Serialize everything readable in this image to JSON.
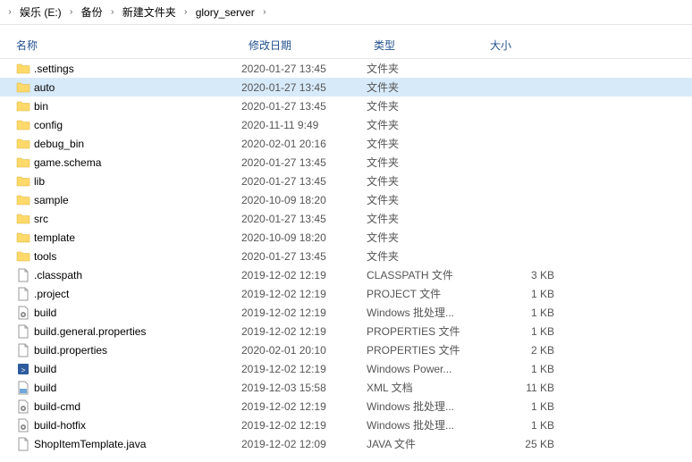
{
  "breadcrumb": [
    "娱乐 (E:)",
    "备份",
    "新建文件夹",
    "glory_server"
  ],
  "columns": {
    "name": "名称",
    "date": "修改日期",
    "type": "类型",
    "size": "大小"
  },
  "files": [
    {
      "icon": "folder",
      "name": ".settings",
      "date": "2020-01-27 13:45",
      "type": "文件夹",
      "size": "",
      "selected": false
    },
    {
      "icon": "folder",
      "name": "auto",
      "date": "2020-01-27 13:45",
      "type": "文件夹",
      "size": "",
      "selected": true
    },
    {
      "icon": "folder",
      "name": "bin",
      "date": "2020-01-27 13:45",
      "type": "文件夹",
      "size": "",
      "selected": false
    },
    {
      "icon": "folder",
      "name": "config",
      "date": "2020-11-11 9:49",
      "type": "文件夹",
      "size": "",
      "selected": false
    },
    {
      "icon": "folder",
      "name": "debug_bin",
      "date": "2020-02-01 20:16",
      "type": "文件夹",
      "size": "",
      "selected": false
    },
    {
      "icon": "folder",
      "name": "game.schema",
      "date": "2020-01-27 13:45",
      "type": "文件夹",
      "size": "",
      "selected": false
    },
    {
      "icon": "folder",
      "name": "lib",
      "date": "2020-01-27 13:45",
      "type": "文件夹",
      "size": "",
      "selected": false
    },
    {
      "icon": "folder",
      "name": "sample",
      "date": "2020-10-09 18:20",
      "type": "文件夹",
      "size": "",
      "selected": false
    },
    {
      "icon": "folder",
      "name": "src",
      "date": "2020-01-27 13:45",
      "type": "文件夹",
      "size": "",
      "selected": false
    },
    {
      "icon": "folder",
      "name": "template",
      "date": "2020-10-09 18:20",
      "type": "文件夹",
      "size": "",
      "selected": false
    },
    {
      "icon": "folder",
      "name": "tools",
      "date": "2020-01-27 13:45",
      "type": "文件夹",
      "size": "",
      "selected": false
    },
    {
      "icon": "file",
      "name": ".classpath",
      "date": "2019-12-02 12:19",
      "type": "CLASSPATH 文件",
      "size": "3 KB",
      "selected": false
    },
    {
      "icon": "file",
      "name": ".project",
      "date": "2019-12-02 12:19",
      "type": "PROJECT 文件",
      "size": "1 KB",
      "selected": false
    },
    {
      "icon": "gear",
      "name": "build",
      "date": "2019-12-02 12:19",
      "type": "Windows 批处理...",
      "size": "1 KB",
      "selected": false
    },
    {
      "icon": "file",
      "name": "build.general.properties",
      "date": "2019-12-02 12:19",
      "type": "PROPERTIES 文件",
      "size": "1 KB",
      "selected": false
    },
    {
      "icon": "file",
      "name": "build.properties",
      "date": "2020-02-01 20:10",
      "type": "PROPERTIES 文件",
      "size": "2 KB",
      "selected": false
    },
    {
      "icon": "ps",
      "name": "build",
      "date": "2019-12-02 12:19",
      "type": "Windows Power...",
      "size": "1 KB",
      "selected": false
    },
    {
      "icon": "xml",
      "name": "build",
      "date": "2019-12-03 15:58",
      "type": "XML 文档",
      "size": "11 KB",
      "selected": false
    },
    {
      "icon": "gear",
      "name": "build-cmd",
      "date": "2019-12-02 12:19",
      "type": "Windows 批处理...",
      "size": "1 KB",
      "selected": false
    },
    {
      "icon": "gear",
      "name": "build-hotfix",
      "date": "2019-12-02 12:19",
      "type": "Windows 批处理...",
      "size": "1 KB",
      "selected": false
    },
    {
      "icon": "file",
      "name": "ShopItemTemplate.java",
      "date": "2019-12-02 12:09",
      "type": "JAVA 文件",
      "size": "25 KB",
      "selected": false
    }
  ]
}
